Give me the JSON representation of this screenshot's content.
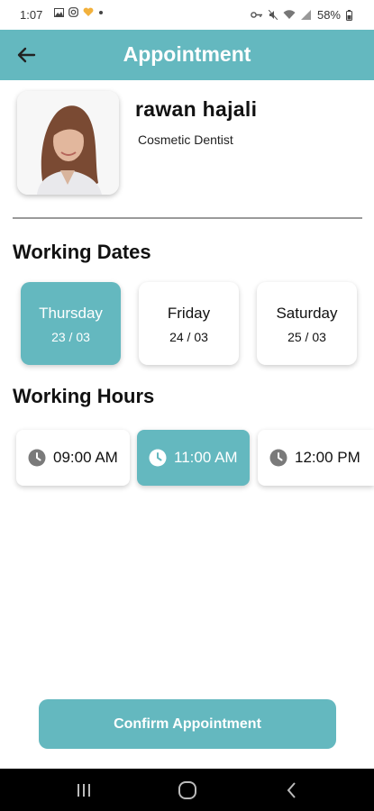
{
  "status_bar": {
    "time": "1:07",
    "battery": "58%"
  },
  "app_bar": {
    "title": "Appointment"
  },
  "doctor": {
    "name": "rawan hajali",
    "specialty": "Cosmetic Dentist"
  },
  "working_dates": {
    "title": "Working Dates",
    "items": [
      {
        "day": "Thursday",
        "date": "23 / 03",
        "selected": true
      },
      {
        "day": "Friday",
        "date": "24 / 03",
        "selected": false
      },
      {
        "day": "Saturday",
        "date": "25 / 03",
        "selected": false
      }
    ]
  },
  "working_hours": {
    "title": "Working Hours",
    "items": [
      {
        "time": "09:00 AM",
        "selected": false
      },
      {
        "time": "11:00 AM",
        "selected": true
      },
      {
        "time": "12:00 PM",
        "selected": false
      }
    ]
  },
  "confirm_button": "Confirm Appointment",
  "colors": {
    "accent": "#64b8bf"
  }
}
